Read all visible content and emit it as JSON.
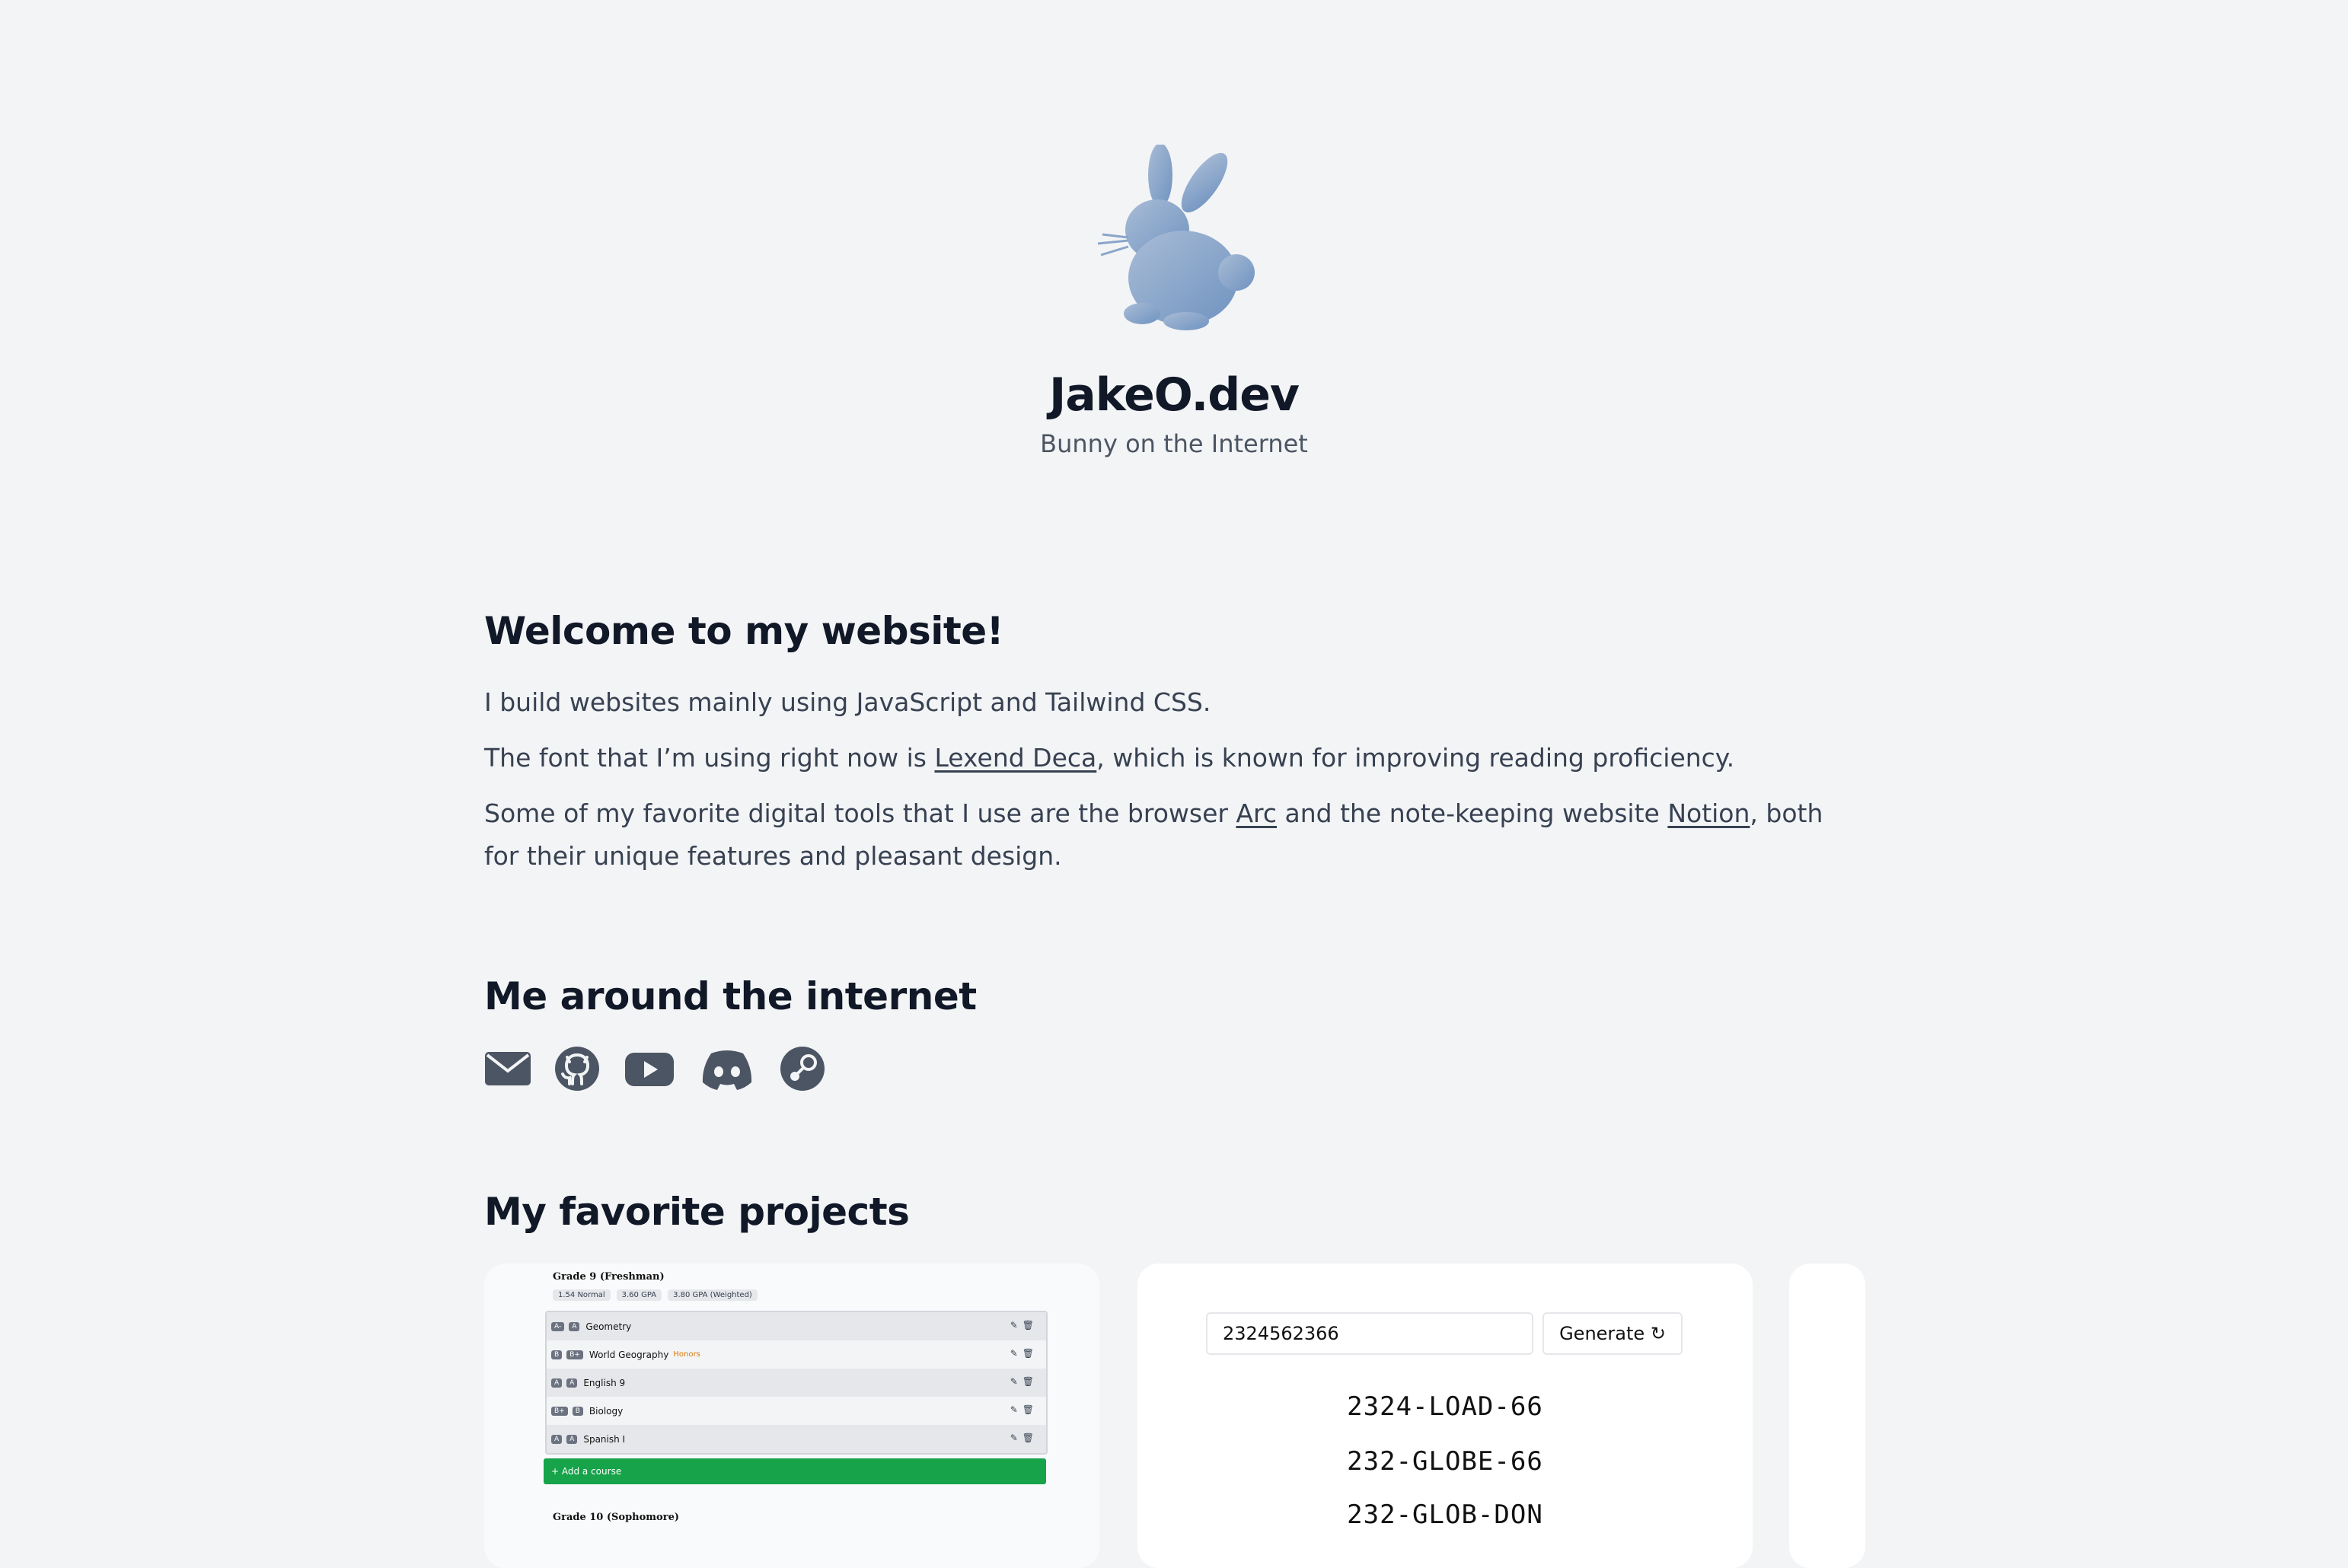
{
  "header": {
    "title": "JakeO.dev",
    "subtitle": "Bunny on the Internet",
    "logo_icon": "bunny-icon",
    "logo_color": "#7b9cc4"
  },
  "welcome": {
    "heading": "Welcome to my website!",
    "p1": "I build websites mainly using JavaScript and Tailwind CSS.",
    "p2_pre": "The font that I’m using right now is ",
    "p2_link": "Lexend Deca",
    "p2_post": ", which is known for improving reading proficiency.",
    "p3_pre": "Some of my favorite digital tools that I use are the browser ",
    "p3_link1": "Arc",
    "p3_mid": " and the note-keeping website ",
    "p3_link2": "Notion",
    "p3_post": ", both for their unique features and pleasant design."
  },
  "internet": {
    "heading": "Me around the internet",
    "icons": [
      "email-icon",
      "github-icon",
      "youtube-icon",
      "discord-icon",
      "steam-icon"
    ],
    "icon_color": "#4b5563"
  },
  "projects": {
    "heading": "My favorite projects",
    "grades_card": {
      "heading1": "Grade 9 (Freshman)",
      "pills": [
        "1.54 Normal",
        "3.60 GPA",
        "3.80 GPA (Weighted)"
      ],
      "rows": [
        {
          "b1": "A-",
          "b2": "A",
          "name": "Geometry",
          "honors": ""
        },
        {
          "b1": "B",
          "b2": "B+",
          "name": "World Geography",
          "honors": "Honors"
        },
        {
          "b1": "A",
          "b2": "A",
          "name": "English 9",
          "honors": ""
        },
        {
          "b1": "B+",
          "b2": "B",
          "name": "Biology",
          "honors": ""
        },
        {
          "b1": "A",
          "b2": "A",
          "name": "Spanish I",
          "honors": ""
        }
      ],
      "add_label": "+ Add a course",
      "heading2": "Grade 10 (Sophomore)"
    },
    "phone_card": {
      "input_value": "2324562366",
      "button_label": "Generate",
      "button_icon": "refresh-icon",
      "combos": [
        "2324-LOAD-66",
        "232-GLOBE-66",
        "232-GLOB-DON"
      ]
    }
  }
}
